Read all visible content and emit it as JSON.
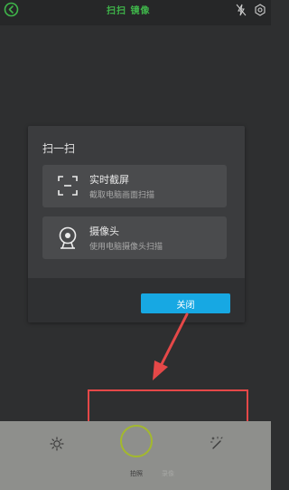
{
  "header": {
    "logo_text": "扫扫 镜像",
    "icons": [
      "back-icon",
      "flash-off-icon",
      "settings-icon"
    ]
  },
  "dialog": {
    "title": "扫一扫",
    "options": [
      {
        "label": "实时截屏",
        "description": "截取电脑画面扫描",
        "icon": "screen-capture-icon"
      },
      {
        "label": "摄像头",
        "description": "使用电脑摄像头扫描",
        "icon": "webcam-icon"
      }
    ],
    "close_label": "关闭"
  },
  "bottom_bar": {
    "modes": [
      "拍照",
      "录像"
    ],
    "active_mode": "拍照",
    "icons": [
      "brightness-icon",
      "magic-wand-icon"
    ]
  },
  "colors": {
    "accent_green": "#3fb54a",
    "close_button_blue": "#17a8e3",
    "shutter_ring": "#a3b92c",
    "annotation_red": "#e54848",
    "background": "#2e2f30",
    "bottom_bar": "#8e8f8c"
  }
}
